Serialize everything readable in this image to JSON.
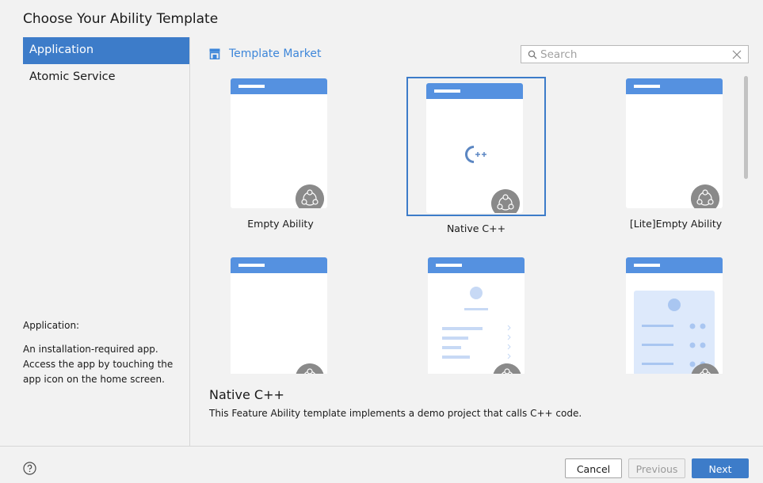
{
  "dialog": {
    "title": "Choose Your Ability Template"
  },
  "sidebar": {
    "items": [
      {
        "label": "Application",
        "active": true
      },
      {
        "label": "Atomic Service",
        "active": false
      }
    ],
    "description": {
      "heading": "Application:",
      "body": "An installation-required app. Access the app by touching the app icon on the home screen."
    }
  },
  "header": {
    "market_label": "Template Market",
    "market_icon": "store-icon",
    "search": {
      "placeholder": "Search",
      "value": ""
    }
  },
  "templates": [
    {
      "label": "Empty Ability",
      "selected": false,
      "thumb": "blank"
    },
    {
      "label": "Native C++",
      "selected": true,
      "thumb": "cpp"
    },
    {
      "label": "[Lite]Empty Ability",
      "selected": false,
      "thumb": "blank"
    },
    {
      "label": "",
      "selected": false,
      "thumb": "blank"
    },
    {
      "label": "",
      "selected": false,
      "thumb": "list"
    },
    {
      "label": "",
      "selected": false,
      "thumb": "grid"
    }
  ],
  "detail": {
    "title": "Native C++",
    "body": "This Feature Ability template implements a demo project that calls C++ code."
  },
  "footer": {
    "cancel_label": "Cancel",
    "previous_label": "Previous",
    "next_label": "Next"
  },
  "colors": {
    "accent": "#3d7cc9",
    "thumb_bar": "#5591e0",
    "market_text": "#3d86d9"
  }
}
